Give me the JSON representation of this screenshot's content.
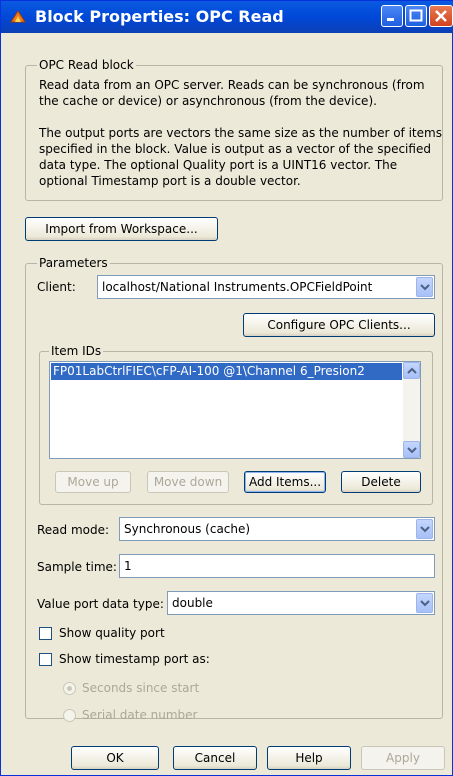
{
  "window": {
    "title": "Block Properties: OPC Read"
  },
  "block_group": {
    "legend": "OPC Read block",
    "description_lines": [
      "Read data from an OPC server. Reads can be synchronous (from",
      "the cache or device) or asynchronous (from the device).",
      "",
      "The output ports are vectors the same size as the number of items",
      "specified in the block. Value is output as a vector of the specified",
      "data type. The optional Quality port is a UINT16 vector. The",
      "optional Timestamp port is a double vector."
    ]
  },
  "import_button": "Import from Workspace...",
  "parameters": {
    "legend": "Parameters",
    "client_label": "Client:",
    "client_value": "localhost/National Instruments.OPCFieldPoint",
    "configure_button": "Configure OPC Clients...",
    "item_ids": {
      "legend": "Item IDs",
      "items": [
        "FP01LabCtrlFIEC\\cFP-AI-100 @1\\Channel 6_Presion2"
      ],
      "move_up": "Move up",
      "move_down": "Move down",
      "add_items": "Add Items...",
      "delete": "Delete"
    },
    "read_mode_label": "Read mode:",
    "read_mode_value": "Synchronous (cache)",
    "sample_time_label": "Sample time:",
    "sample_time_value": "1",
    "value_port_label": "Value port data type:",
    "value_port_value": "double",
    "show_quality": "Show quality port",
    "show_timestamp": "Show timestamp port as:",
    "radio_seconds": "Seconds since start",
    "radio_serial": "Serial date number"
  },
  "footer": {
    "ok": "OK",
    "cancel": "Cancel",
    "help": "Help",
    "apply": "Apply"
  },
  "colors": {
    "titlebar": "#0a5ae0",
    "selection": "#316ac5",
    "dialog_bg": "#ece9d8"
  }
}
